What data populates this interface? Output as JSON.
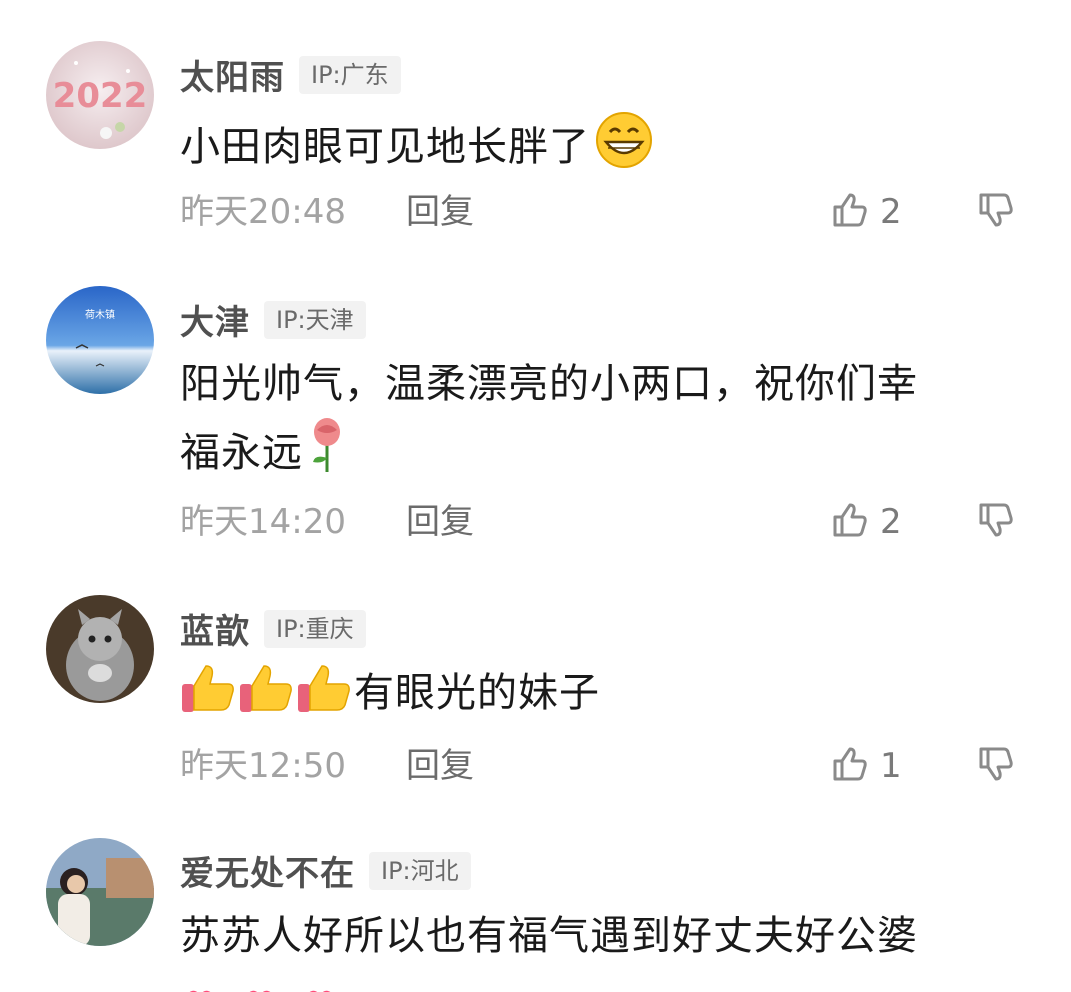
{
  "comments": [
    {
      "username": "太阳雨",
      "ip": "IP:广东",
      "text": "小田肉眼可见地长胖了",
      "time": "昨天20:48",
      "reply": "回复",
      "likes": "2",
      "emoji": "grinning-face"
    },
    {
      "username": "大津",
      "ip": "IP:天津",
      "text_line1": "阳光帅气，温柔漂亮的小两口，祝你们幸",
      "text_line2": "福永远",
      "time": "昨天14:20",
      "reply": "回复",
      "likes": "2",
      "emoji": "rose"
    },
    {
      "username": "蓝歆",
      "ip": "IP:重庆",
      "text": "有眼光的妹子",
      "time": "昨天12:50",
      "reply": "回复",
      "likes": "1",
      "emoji": "thumbs-up"
    },
    {
      "username": "爱无处不在",
      "ip": "IP:河北",
      "text": "苏苏人好所以也有福气遇到好丈夫好公婆",
      "emoji": "sparkling-heart"
    }
  ],
  "avatar_texts": {
    "avatar1": "2022",
    "avatar2": "荷木镇"
  },
  "colors": {
    "username": "#505050",
    "ip_badge_bg": "#f2f2f2",
    "time": "#a3a3a3",
    "icon": "#8a8a8a"
  }
}
